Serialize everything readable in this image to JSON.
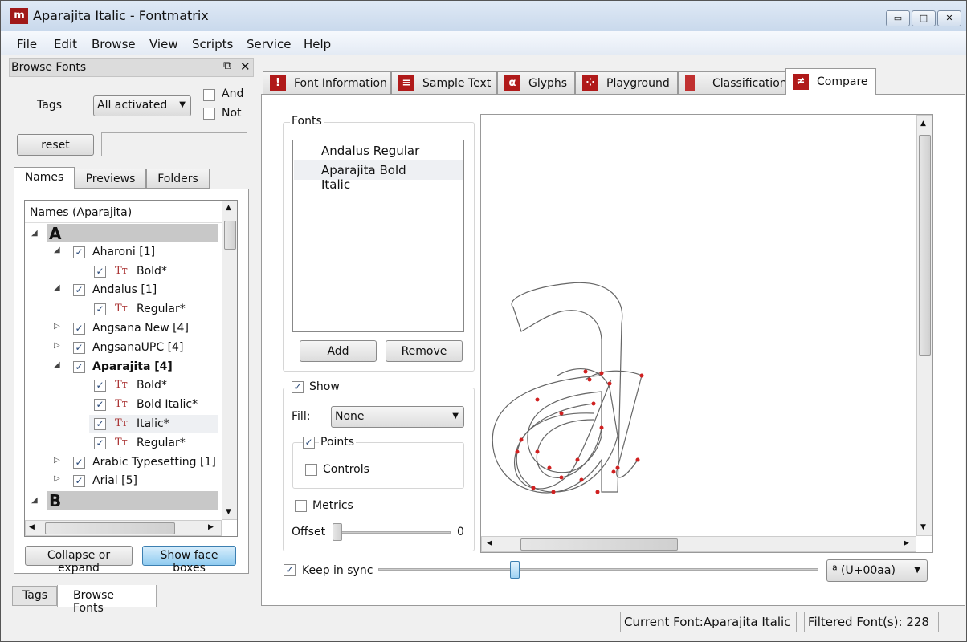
{
  "window": {
    "title": "Aparajita Italic - Fontmatrix",
    "minimize": "▭",
    "maximize": "□",
    "close": "✕"
  },
  "menu": [
    "File",
    "Edit",
    "Browse",
    "View",
    "Scripts",
    "Service",
    "Help"
  ],
  "dock": {
    "title": "Browse Fonts",
    "tags_label": "Tags",
    "tags_value": "All activated",
    "and_label": "And",
    "not_label": "Not",
    "reset_label": "reset",
    "search_value": "",
    "tabs": [
      "Names",
      "Previews",
      "Folders"
    ],
    "tree_header": "Names (Aparajita)",
    "rows": [
      {
        "label": "A",
        "level": 0,
        "type": "letter"
      },
      {
        "label": "Aharoni  [1]",
        "level": 1,
        "expanded": true,
        "checked": true
      },
      {
        "label": "Bold*",
        "level": 2,
        "checked": true
      },
      {
        "label": "Andalus  [1]",
        "level": 1,
        "expanded": true,
        "checked": true
      },
      {
        "label": "Regular*",
        "level": 2,
        "checked": true
      },
      {
        "label": "Angsana New  [4]",
        "level": 1,
        "expanded": false,
        "checked": true
      },
      {
        "label": "AngsanaUPC  [4]",
        "level": 1,
        "expanded": false,
        "checked": true
      },
      {
        "label": "Aparajita  [4]",
        "level": 1,
        "expanded": true,
        "checked": true,
        "bold": true
      },
      {
        "label": "Bold*",
        "level": 2,
        "checked": true
      },
      {
        "label": "Bold Italic*",
        "level": 2,
        "checked": true
      },
      {
        "label": "Italic*",
        "level": 2,
        "checked": true,
        "selected": true
      },
      {
        "label": "Regular*",
        "level": 2,
        "checked": true
      },
      {
        "label": "Arabic Typesetting  [1]",
        "level": 1,
        "expanded": false,
        "checked": true
      },
      {
        "label": "Arial  [5]",
        "level": 1,
        "expanded": false,
        "checked": true
      },
      {
        "label": "B",
        "level": 0,
        "type": "letter"
      }
    ],
    "collapse_label": "Collapse or expand",
    "show_face_label": "Show face boxes",
    "bottom_tabs": [
      "Tags",
      "Browse Fonts"
    ]
  },
  "main": {
    "tabs": [
      {
        "label": "Font Information",
        "icon": "info-icon"
      },
      {
        "label": "Sample Text",
        "icon": "text-icon"
      },
      {
        "label": "Glyphs",
        "icon": "glyph-icon"
      },
      {
        "label": "Playground",
        "icon": "dice-icon"
      },
      {
        "label": "Classification",
        "icon": "classification-icon"
      },
      {
        "label": "Compare",
        "icon": "not-equal-icon",
        "active": true
      }
    ],
    "fonts_group": "Fonts",
    "fonts": [
      "Andalus Regular",
      "Aparajita Bold Italic"
    ],
    "add_label": "Add",
    "remove_label": "Remove",
    "show_label": "Show",
    "fill_label": "Fill:",
    "fill_value": "None",
    "points_label": "Points",
    "controls_label": "Controls",
    "metrics_label": "Metrics",
    "offset_label": "Offset",
    "offset_value": "0",
    "keep_sync_label": "Keep in sync",
    "glyph_value": "ª  (U+00aa)",
    "sync_slider_fraction": 0.2
  },
  "status": {
    "current": "Current Font:Aparajita Italic",
    "filtered": "Filtered Font(s): 228"
  },
  "colors": {
    "accent": "#b01a1a",
    "points": "#d02020",
    "selection": "#cde4f7"
  }
}
